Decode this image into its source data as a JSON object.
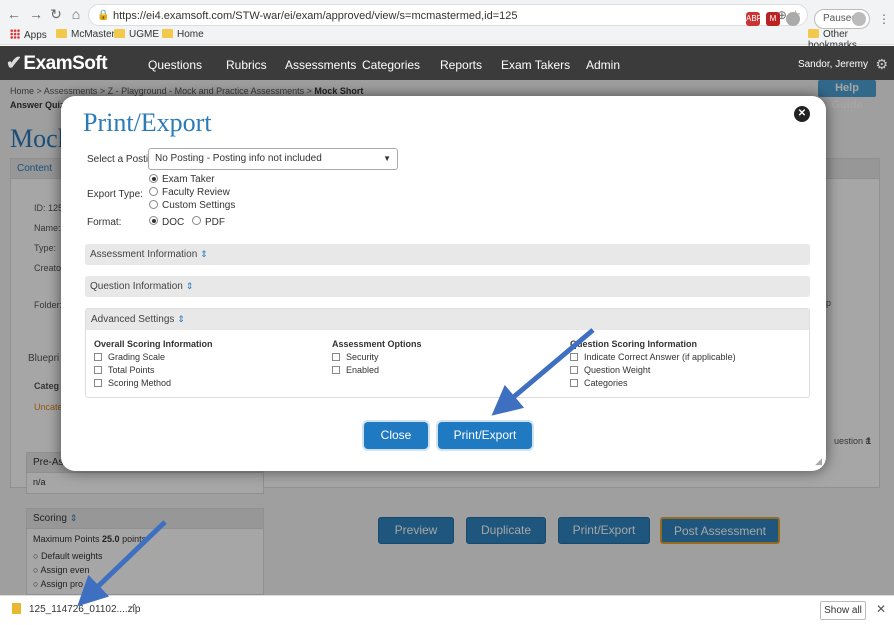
{
  "browser": {
    "url": "https://ei4.examsoft.com/STW-war/ei/exam/approved/view/s=mcmastermed,id=125",
    "paused_label": "Paused",
    "bookmarks": [
      "Apps",
      "McMaster",
      "UGME",
      "Home"
    ],
    "other_bookmarks": "Other bookmarks"
  },
  "app": {
    "logo": "ExamSoft",
    "nav": [
      "Questions",
      "Rubrics",
      "Assessments",
      "Categories",
      "Reports",
      "Exam Takers",
      "Admin"
    ],
    "user": "Sandor, Jeremy",
    "help": "Help Guide"
  },
  "page": {
    "breadcrumb": [
      "Home",
      "Assessments",
      "Z - Playground - Mock and Practice Assessments",
      "Mock Short"
    ],
    "subcrumb": "Answer Quiz S",
    "title": "Mock",
    "content_tab": "Content",
    "details": [
      "ID: 125",
      "Name:",
      "Type:",
      "Creato",
      "Folder:"
    ],
    "blueprint": "Bluepri",
    "blueprint_cat": "Categ",
    "blueprint_uncat": "Uncate",
    "pre_assess": "Pre-Asse",
    "pre_assess_val": "n/a",
    "scoring": "Scoring",
    "max_points_label": "Maximum Points",
    "max_points_value": "25.0",
    "max_points_unit": "points",
    "default_weights": "Default weights",
    "assign_even": "Assign even",
    "assign_pro": "Assign pro",
    "right_p": "p",
    "question_no_label": "uestion #",
    "question_no_value": "1",
    "bottom_buttons": [
      "Preview",
      "Duplicate",
      "Print/Export",
      "Post Assessment"
    ]
  },
  "modal": {
    "title": "Print/Export",
    "posting_label": "Select a Posting:",
    "posting_value": "No Posting - Posting info not included",
    "export_type_label": "Export Type:",
    "export_types": [
      "Exam Taker",
      "Faculty Review",
      "Custom Settings"
    ],
    "export_selected": "Exam Taker",
    "format_label": "Format:",
    "formats": [
      "DOC",
      "PDF"
    ],
    "format_selected": "DOC",
    "sections": [
      "Assessment Information",
      "Question Information",
      "Advanced Settings"
    ],
    "advanced": {
      "col1_title": "Overall Scoring Information",
      "col1_items": [
        "Grading Scale",
        "Total Points",
        "Scoring Method"
      ],
      "col2_title": "Assessment Options",
      "col2_items": [
        "Security",
        "Enabled"
      ],
      "col3_title": "Question Scoring Information",
      "col3_items": [
        "Indicate Correct Answer (if applicable)",
        "Question Weight",
        "Categories"
      ]
    },
    "close_label": "Close",
    "export_label": "Print/Export"
  },
  "download": {
    "filename": "125_114726_01102....zip",
    "show_all": "Show all"
  },
  "colors": {
    "accent": "#2a7ab8",
    "button": "#1f7ac2",
    "nav_bg": "#3b3b3b",
    "arrow": "#3f6fc0"
  }
}
